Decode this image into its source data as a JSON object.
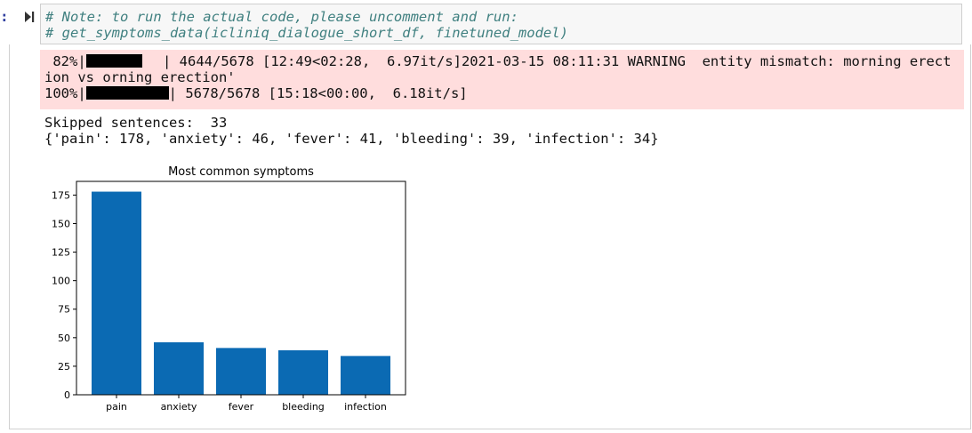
{
  "code": {
    "line1": "# Note: to run the actual code, please uncomment and run:",
    "line2": "# get_symptoms_data(icliniq_dialogue_short_df, finetuned_model)"
  },
  "stderr": {
    "p1_pct": " 82%|",
    "p1_rest": " | 4644/5678 [12:49<02:28,  6.97it/s]2021-03-15 08:11:31 WARNING  entity mismatch: morning erect",
    "p1_wrap": "ion vs orning erection'",
    "p2_pct": "100%|",
    "p2_rest": "| 5678/5678 [15:18<00:00,  6.18it/s]",
    "progress_1": 0.82,
    "progress_2": 1.0
  },
  "stdout": {
    "skipped": "Skipped sentences:  33",
    "dict": "{'pain': 178, 'anxiety': 46, 'fever': 41, 'bleeding': 39, 'infection': 34}"
  },
  "colors": {
    "bar": "#0b6ab3",
    "stderr_bg": "#ffdddd",
    "prompt": "#303f9f",
    "comment": "#408080"
  },
  "chart_data": {
    "type": "bar",
    "title": "Most common symptoms",
    "categories": [
      "pain",
      "anxiety",
      "fever",
      "bleeding",
      "infection"
    ],
    "values": [
      178,
      46,
      41,
      39,
      34
    ],
    "ylim": [
      0,
      187
    ],
    "yticks": [
      "0",
      "25",
      "50",
      "75",
      "100",
      "125",
      "150",
      "175"
    ],
    "xlabel": "",
    "ylabel": "",
    "grid": false
  }
}
